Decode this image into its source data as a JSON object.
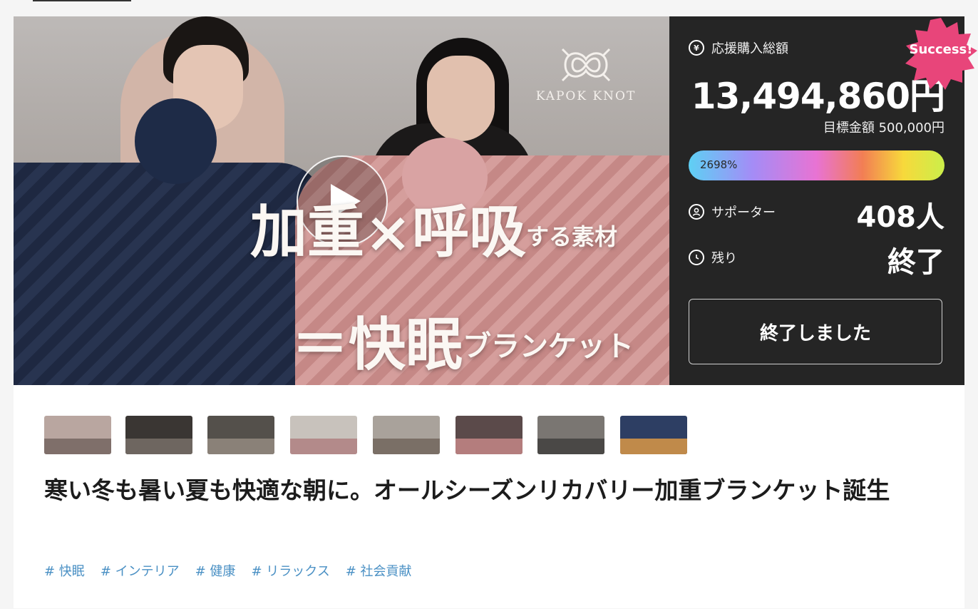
{
  "hero": {
    "brand": "KAPOK KNOT",
    "headline_line1_big1": "加重",
    "headline_line1_sep": "×",
    "headline_line1_big2": "呼吸",
    "headline_line1_small": "する素材",
    "headline_line2_eq": "＝",
    "headline_line2_big": "快眠",
    "headline_line2_small": "ブランケット"
  },
  "panel": {
    "total_label": "応援購入総額",
    "total_amount": "13,494,860円",
    "goal": "目標金額 500,000円",
    "progress_text": "2698%",
    "progress_percent": 2698,
    "supporters_label": "サポーター",
    "supporters_value": "408人",
    "remaining_label": "残り",
    "remaining_value": "終了",
    "ended_button": "終了しました",
    "success_badge": "Success!",
    "success_color": "#e8457a"
  },
  "thumbnails": [
    {
      "color": "#b9a6a0",
      "accent": "#7f6f6a",
      "active": true
    },
    {
      "color": "#3a3633",
      "accent": "#6e6660",
      "active": false
    },
    {
      "color": "#54504b",
      "accent": "#8a8178",
      "active": false
    },
    {
      "color": "#c8c2bc",
      "accent": "#b38a8a",
      "active": false
    },
    {
      "color": "#a9a29b",
      "accent": "#7a6f66",
      "active": false
    },
    {
      "color": "#5b4a4a",
      "accent": "#b47d7d",
      "active": false
    },
    {
      "color": "#7a7672",
      "accent": "#4a4846",
      "active": false
    },
    {
      "color": "#2d3e63",
      "accent": "#c08a4a",
      "active": false
    }
  ],
  "title": "寒い冬も暑い夏も快適な朝に。オールシーズンリカバリー加重ブランケット誕生",
  "tags": [
    "# 快眠",
    "# インテリア",
    "# 健康",
    "# リラックス",
    "# 社会貢献"
  ]
}
